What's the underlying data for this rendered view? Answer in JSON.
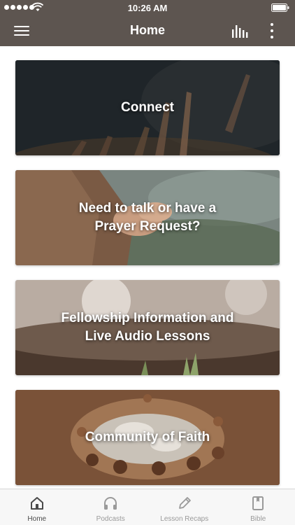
{
  "status_bar": {
    "time": "10:26 AM"
  },
  "header": {
    "title": "Home"
  },
  "cards": [
    {
      "title": "Connect"
    },
    {
      "title": "Need to talk or have a\nPrayer Request?"
    },
    {
      "title": "Fellowship Information and\nLive Audio Lessons"
    },
    {
      "title": "Community of Faith"
    }
  ],
  "tabs": [
    {
      "label": "Home",
      "icon": "home-icon",
      "active": true
    },
    {
      "label": "Podcasts",
      "icon": "headphones-icon",
      "active": false
    },
    {
      "label": "Lesson Recaps",
      "icon": "pencil-icon",
      "active": false
    },
    {
      "label": "Bible",
      "icon": "book-icon",
      "active": false
    }
  ],
  "colors": {
    "header": "#5d5550",
    "active_tab": "#4a4a4a",
    "inactive_tab": "#9a9a9a"
  }
}
